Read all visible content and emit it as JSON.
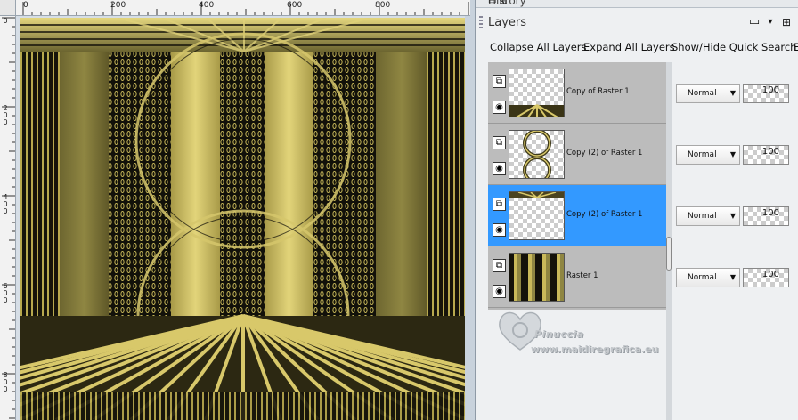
{
  "ruler": {
    "top_labels": [
      "0",
      "200",
      "400",
      "600",
      "800"
    ],
    "left_labels": [
      "0",
      "2\n0\n0",
      "4\n0\n0",
      "6\n0\n0",
      "8\n0\n0"
    ]
  },
  "panels": {
    "history_title": "History",
    "layers_title": "Layers"
  },
  "toolbar": {
    "collapse_label": "Collapse All Layers",
    "expand_label": "Expand All Layers",
    "quicksearch_label": "Show/Hide Quick Search",
    "cut_label": "E"
  },
  "layers": [
    {
      "name": "Copy of Raster 1",
      "blend": "Normal",
      "opacity": "100",
      "selected": false
    },
    {
      "name": "Copy (2) of Raster 1",
      "blend": "Normal",
      "opacity": "100",
      "selected": false
    },
    {
      "name": "Copy (2) of Raster 1",
      "blend": "Normal",
      "opacity": "100",
      "selected": true
    },
    {
      "name": "Raster 1",
      "blend": "Normal",
      "opacity": "100",
      "selected": false
    }
  ],
  "watermark": {
    "name": "Pinuccia",
    "site": "www.maidiregrafica.eu"
  },
  "colors": {
    "gold": "#d8c86a",
    "dark": "#141208",
    "selection": "#3399ff"
  }
}
